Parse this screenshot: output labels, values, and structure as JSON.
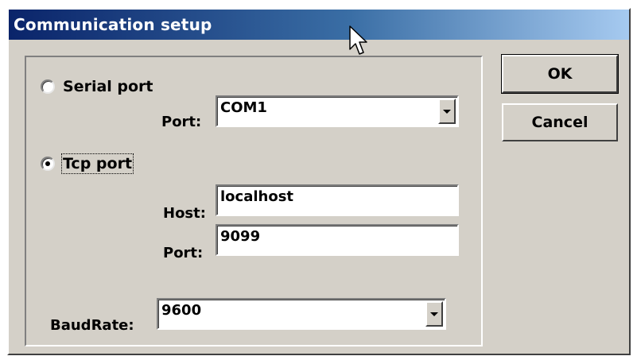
{
  "window": {
    "title": "Communication setup"
  },
  "connection": {
    "serial": {
      "label": "Serial port",
      "selected": false,
      "port_label": "Port:",
      "port_value": "COM1"
    },
    "tcp": {
      "label": "Tcp port",
      "selected": true,
      "host_label": "Host:",
      "host_value": "localhost",
      "port_label": "Port:",
      "port_value": "9099"
    }
  },
  "baud": {
    "label": "BaudRate:",
    "value": "9600"
  },
  "buttons": {
    "ok": "OK",
    "cancel": "Cancel"
  },
  "icons": {
    "dropdown": "chevron-down-icon",
    "cursor": "mouse-pointer-icon"
  }
}
